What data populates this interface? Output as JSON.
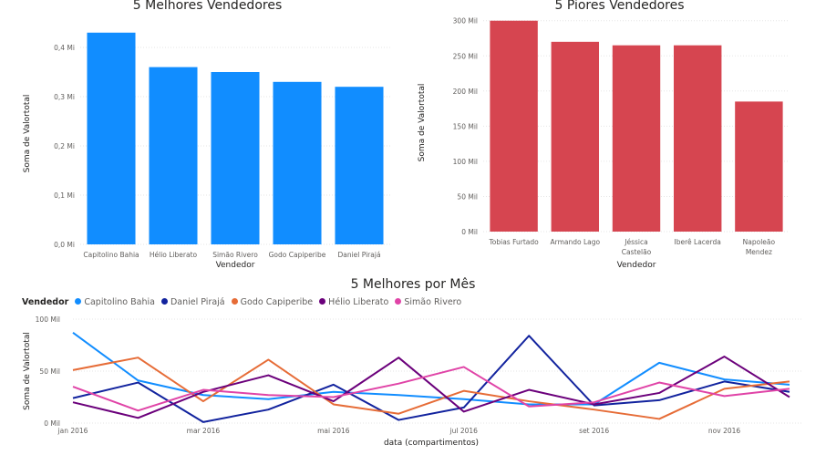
{
  "chart_data": [
    {
      "type": "bar",
      "title": "5 Melhores Vendedores",
      "xlabel": "Vendedor",
      "ylabel": "Soma de Valortotal",
      "color": "#118dff",
      "ylim": [
        0,
        0.45
      ],
      "yticks": [
        0,
        0.1,
        0.2,
        0.3,
        0.4
      ],
      "ytick_labels": [
        "0,0 Mi",
        "0,1 Mi",
        "0,2 Mi",
        "0,3 Mi",
        "0,4 Mi"
      ],
      "categories": [
        "Capitolino Bahia",
        "Hélio Liberato",
        "Simão Rivero",
        "Godo Capiperibe",
        "Daniel Pirajá"
      ],
      "values": [
        0.43,
        0.36,
        0.35,
        0.33,
        0.32
      ]
    },
    {
      "type": "bar",
      "title": "5 Piores Vendedores",
      "xlabel": "Vendedor",
      "ylabel": "Soma de Valortotal",
      "color": "#d64550",
      "ylim": [
        0,
        310
      ],
      "yticks": [
        0,
        50,
        100,
        150,
        200,
        250,
        300
      ],
      "ytick_labels": [
        "0 Mil",
        "50 Mil",
        "100 Mil",
        "150 Mil",
        "200 Mil",
        "250 Mil",
        "300 Mil"
      ],
      "categories": [
        "Tobias Furtado",
        "Armando Lago",
        "Jéssica Castelão",
        "Iberê Lacerda",
        "Napoleão Mendez"
      ],
      "values": [
        300,
        270,
        265,
        265,
        185
      ]
    },
    {
      "type": "line",
      "title": "5 Melhores por Mês",
      "xlabel": "data (compartimentos)",
      "ylabel": "Soma de Valortotal",
      "legend_title": "Vendedor",
      "legend_position": "top-left",
      "ylim": [
        0,
        100
      ],
      "yticks": [
        0,
        50,
        100
      ],
      "ytick_labels": [
        "0 Mil",
        "50 Mil",
        "100 Mil"
      ],
      "x": [
        "2016-01",
        "2016-02",
        "2016-03",
        "2016-04",
        "2016-05",
        "2016-06",
        "2016-07",
        "2016-08",
        "2016-09",
        "2016-10",
        "2016-11",
        "2016-12"
      ],
      "xtick_index": [
        0,
        2,
        4,
        6,
        8,
        10
      ],
      "xtick_labels": [
        "jan 2016",
        "mar 2016",
        "mai 2016",
        "jul 2016",
        "set 2016",
        "nov 2016"
      ],
      "series": [
        {
          "name": "Capitolino Bahia",
          "color": "#118dff",
          "values": [
            87,
            41,
            27,
            23,
            30,
            27,
            23,
            18,
            18,
            58,
            42,
            37
          ]
        },
        {
          "name": "Daniel Pirajá",
          "color": "#12239e",
          "values": [
            24,
            39,
            1,
            13,
            37,
            3,
            15,
            84,
            17,
            22,
            40,
            30
          ]
        },
        {
          "name": "Godo Capiperibe",
          "color": "#e66c37",
          "values": [
            51,
            63,
            21,
            61,
            18,
            9,
            31,
            21,
            13,
            4,
            33,
            40
          ]
        },
        {
          "name": "Hélio Liberato",
          "color": "#6b007b",
          "values": [
            20,
            5,
            30,
            46,
            21,
            63,
            11,
            32,
            18,
            29,
            64,
            25
          ]
        },
        {
          "name": "Simão Rivero",
          "color": "#e044a7",
          "values": [
            35,
            12,
            32,
            27,
            25,
            38,
            54,
            16,
            20,
            39,
            26,
            33
          ]
        }
      ]
    }
  ]
}
